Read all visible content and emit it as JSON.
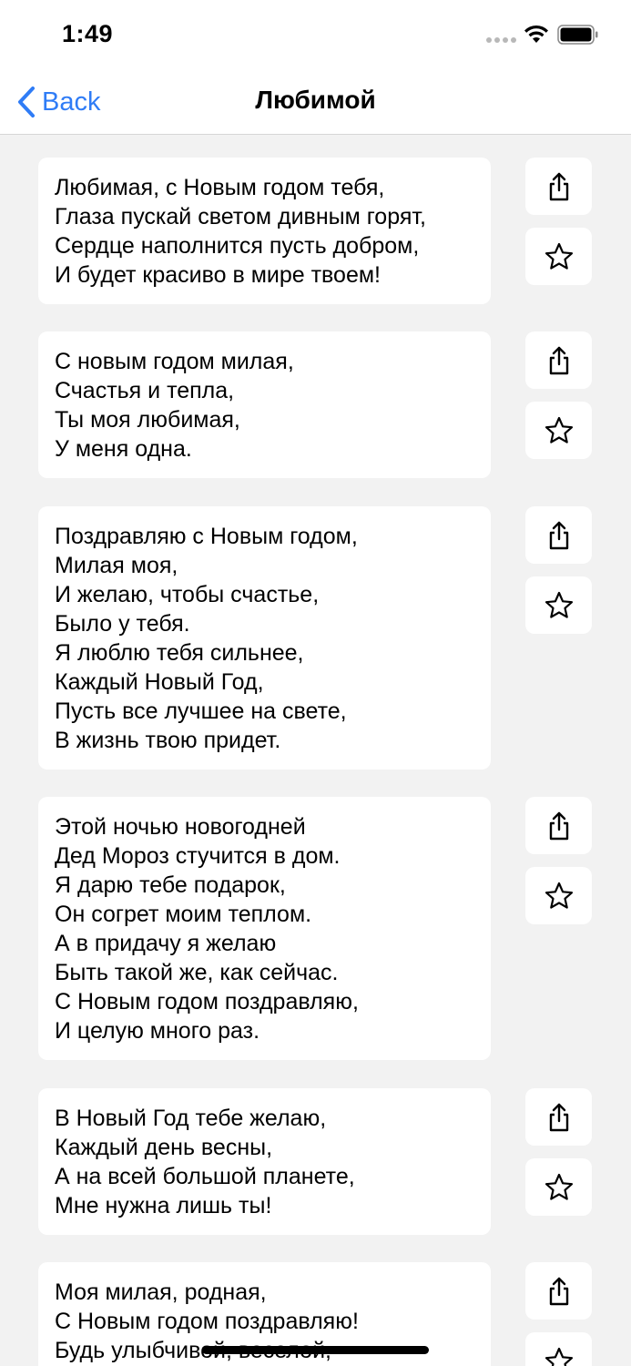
{
  "status_bar": {
    "time": "1:49"
  },
  "nav": {
    "back_label": "Back",
    "title": "Любимой"
  },
  "poems": [
    {
      "lines": [
        "Любимая, с Новым годом тебя,",
        "Глаза пускай светом дивным горят,",
        "Сердце наполнится пусть добром,",
        "И будет красиво в мире твоем!"
      ]
    },
    {
      "lines": [
        "С новым годом милая,",
        "Счастья и тепла,",
        "Ты моя любимая,",
        "У меня одна."
      ]
    },
    {
      "lines": [
        "Поздравляю с Новым годом,",
        "Милая моя,",
        "И желаю, чтобы счастье,",
        "Было у тебя.",
        "Я люблю тебя сильнее,",
        "Каждый Новый Год,",
        "Пусть все лучшее на свете,",
        "В жизнь твою придет."
      ]
    },
    {
      "lines": [
        "Этой ночью новогодней",
        "Дед Мороз стучится в дом.",
        "Я дарю тебе подарок,",
        "Он согрет моим теплом.",
        "А в придачу я желаю",
        "Быть такой же, как сейчас.",
        "С Новым годом поздравляю,",
        "И целую много раз."
      ]
    },
    {
      "lines": [
        "В Новый Год тебе желаю,",
        "Каждый день весны,",
        "А на всей большой планете,",
        "Мне нужна лишь ты!"
      ]
    },
    {
      "lines": [
        "Моя милая, родная,",
        "С Новым годом поздравляю!",
        "Будь улыбчивой, веселой,"
      ]
    }
  ],
  "icons": {
    "share": "share-icon",
    "favorite": "star-icon",
    "back": "chevron-left-icon"
  },
  "colors": {
    "accent": "#2f7cf6",
    "background": "#f2f2f2",
    "card": "#ffffff"
  }
}
